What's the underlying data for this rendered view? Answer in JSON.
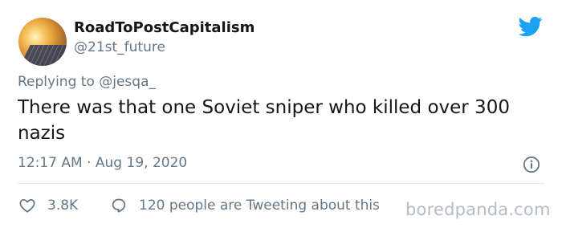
{
  "user": {
    "display_name": "RoadToPostCapitalism",
    "handle": "@21st_future",
    "avatar": "sunset-solar-panel-avatar"
  },
  "reply": {
    "prefix": "Replying to",
    "mention": "@jesqa_"
  },
  "tweet": {
    "text": "There was that one Soviet sniper who killed over 300 nazis",
    "timestamp": "12:17 AM · Aug 19, 2020"
  },
  "actions": {
    "likes": "3.8K",
    "tweeting": "120 people are Tweeting about this"
  },
  "watermark": "boredpanda.com",
  "icons": {
    "brand": "twitter-bird-icon",
    "info": "info-icon",
    "like": "heart-icon",
    "reply": "chat-bubble-icon"
  },
  "colors": {
    "brand_blue": "#1da1f2",
    "text": "#14171a",
    "secondary": "#657786",
    "divider": "#e1e8ed"
  }
}
